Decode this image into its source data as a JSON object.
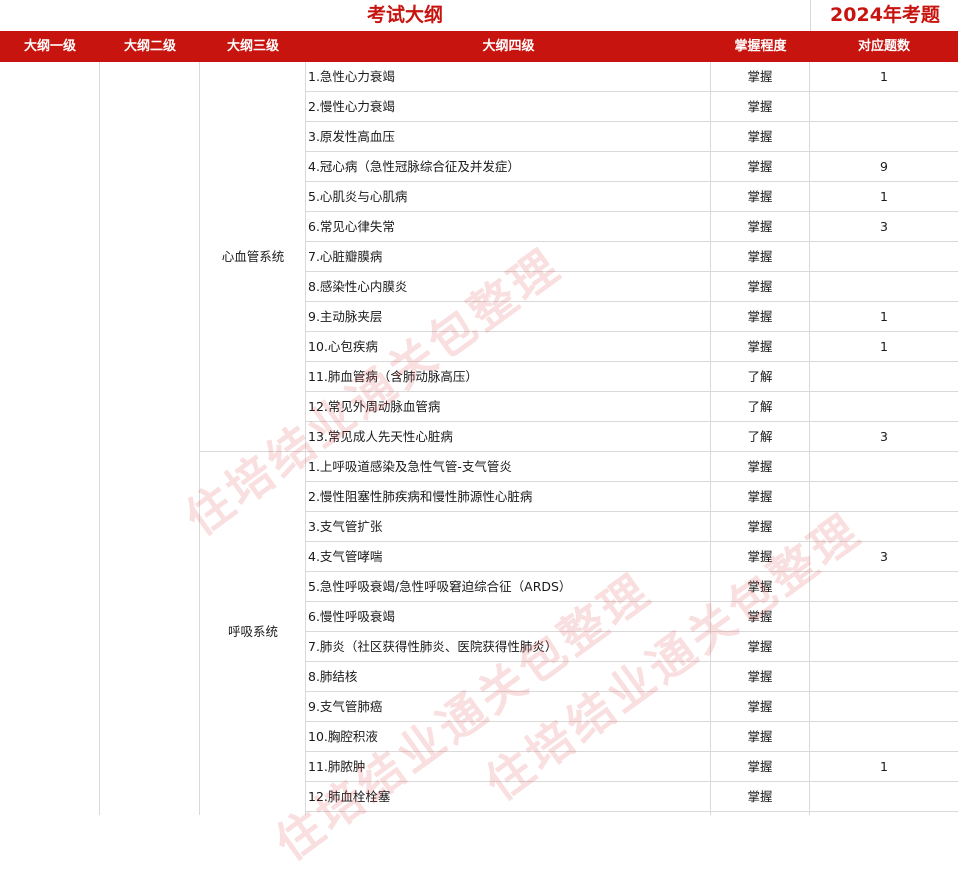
{
  "title": "考试大纲",
  "year_title": "2024年考题",
  "headers": {
    "level1": "大纲一级",
    "level2": "大纲二级",
    "level3": "大纲三级",
    "level4": "大纲四级",
    "mastery": "掌握程度",
    "count": "对应题数"
  },
  "watermark": "住培结业通关包整理",
  "colors": {
    "accent": "#c8140f",
    "grid": "#d9d9d9"
  },
  "systems": [
    {
      "name": "心血管系统",
      "rows": [
        {
          "topic": "1.急性心力衰竭",
          "mastery": "掌握",
          "count": "1"
        },
        {
          "topic": "2.慢性心力衰竭",
          "mastery": "掌握",
          "count": ""
        },
        {
          "topic": "3.原发性高血压",
          "mastery": "掌握",
          "count": ""
        },
        {
          "topic": "4.冠心病（急性冠脉综合征及并发症）",
          "mastery": "掌握",
          "count": "9"
        },
        {
          "topic": "5.心肌炎与心肌病",
          "mastery": "掌握",
          "count": "1"
        },
        {
          "topic": "6.常见心律失常",
          "mastery": "掌握",
          "count": "3"
        },
        {
          "topic": "7.心脏瓣膜病",
          "mastery": "掌握",
          "count": ""
        },
        {
          "topic": "8.感染性心内膜炎",
          "mastery": "掌握",
          "count": ""
        },
        {
          "topic": "9.主动脉夹层",
          "mastery": "掌握",
          "count": "1"
        },
        {
          "topic": "10.心包疾病",
          "mastery": "掌握",
          "count": "1"
        },
        {
          "topic": "11.肺血管病（含肺动脉高压）",
          "mastery": "了解",
          "count": ""
        },
        {
          "topic": "12.常见外周动脉血管病",
          "mastery": "了解",
          "count": ""
        },
        {
          "topic": "13.常见成人先天性心脏病",
          "mastery": "了解",
          "count": "3"
        }
      ]
    },
    {
      "name": "呼吸系统",
      "rows": [
        {
          "topic": "1.上呼吸道感染及急性气管-支气管炎",
          "mastery": "掌握",
          "count": ""
        },
        {
          "topic": "2.慢性阻塞性肺疾病和慢性肺源性心脏病",
          "mastery": "掌握",
          "count": ""
        },
        {
          "topic": "3.支气管扩张",
          "mastery": "掌握",
          "count": ""
        },
        {
          "topic": "4.支气管哮喘",
          "mastery": "掌握",
          "count": "3"
        },
        {
          "topic": "5.急性呼吸衰竭/急性呼吸窘迫综合征（ARDS）",
          "mastery": "掌握",
          "count": ""
        },
        {
          "topic": "6.慢性呼吸衰竭",
          "mastery": "掌握",
          "count": ""
        },
        {
          "topic": "7.肺炎（社区获得性肺炎、医院获得性肺炎）",
          "mastery": "掌握",
          "count": ""
        },
        {
          "topic": "8.肺结核",
          "mastery": "掌握",
          "count": ""
        },
        {
          "topic": "9.支气管肺癌",
          "mastery": "掌握",
          "count": ""
        },
        {
          "topic": "10.胸腔积液",
          "mastery": "掌握",
          "count": ""
        },
        {
          "topic": "11.肺脓肿",
          "mastery": "掌握",
          "count": "1"
        },
        {
          "topic": "12.肺血栓栓塞",
          "mastery": "掌握",
          "count": ""
        }
      ]
    }
  ]
}
